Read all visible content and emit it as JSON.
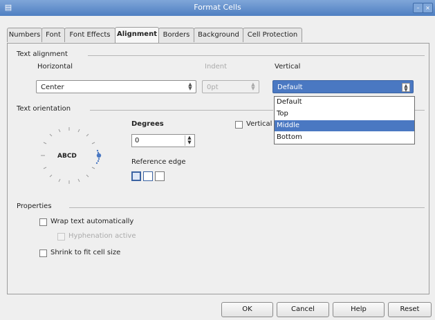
{
  "window": {
    "title": "Format Cells",
    "menu_icon": "window-menu-icon",
    "minimize_glyph": "–",
    "close_glyph": "×"
  },
  "tabs": [
    {
      "label": "Numbers",
      "active": false
    },
    {
      "label": "Font",
      "active": false
    },
    {
      "label": "Font Effects",
      "active": false
    },
    {
      "label": "Alignment",
      "active": true
    },
    {
      "label": "Borders",
      "active": false
    },
    {
      "label": "Background",
      "active": false
    },
    {
      "label": "Cell Protection",
      "active": false
    }
  ],
  "text_alignment": {
    "section_label": "Text alignment",
    "horizontal_label": "Horizontal",
    "horizontal_value": "Center",
    "indent_label": "Indent",
    "indent_value": "0pt",
    "vertical_label": "Vertical",
    "vertical_value": "Default",
    "vertical_options": [
      "Default",
      "Top",
      "Middle",
      "Bottom"
    ],
    "vertical_highlighted": "Middle"
  },
  "text_orientation": {
    "section_label": "Text orientation",
    "dial_text": "ABCD",
    "degrees_label": "Degrees",
    "degrees_value": "0",
    "reference_edge_label": "Reference edge",
    "vertically_stacked_label": "Vertically stacked"
  },
  "properties": {
    "section_label": "Properties",
    "wrap_text": "Wrap text automatically",
    "hyphenation": "Hyphenation active",
    "shrink": "Shrink to fit cell size"
  },
  "buttons": {
    "ok": "OK",
    "cancel": "Cancel",
    "help": "Help",
    "reset": "Reset"
  },
  "colors": {
    "accent": "#4a78c2",
    "titlebar": "#5b87c8"
  }
}
